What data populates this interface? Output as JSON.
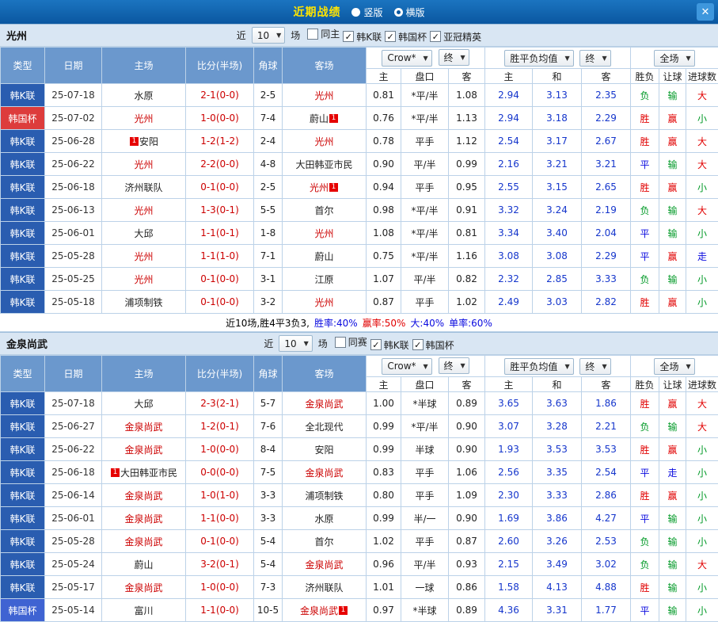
{
  "titlebar": {
    "title": "近期战绩",
    "radios": [
      {
        "label": "竖版",
        "selected": false
      },
      {
        "label": "横版",
        "selected": true
      }
    ],
    "close_label": "✕"
  },
  "icons": {
    "arrow": "▼",
    "check": "✓",
    "badge": "1"
  },
  "palette": {
    "k": "#2a5db0",
    "cupRed": "#dd3c3c",
    "cupBlue": "#3f63d2"
  },
  "result_colors": {
    "胜": "#e10000",
    "赢": "#e10000",
    "大": "#e10000",
    "平": "#0a0adf",
    "走": "#0a0adf",
    "负": "#009926",
    "输": "#009926",
    "小": "#009926"
  },
  "head": {
    "cols": [
      "类型",
      "日期",
      "主场",
      "比分(半场)",
      "角球",
      "客场"
    ],
    "odds_select": "Crow*",
    "final_select": "终",
    "europe_select": "胜平负均值",
    "scope_select": "全场",
    "sub": [
      "主",
      "盘口",
      "客",
      "主",
      "和",
      "客",
      "胜负",
      "让球",
      "进球数"
    ]
  },
  "filters_shared": {
    "near": "近",
    "count": "10",
    "games": "场"
  },
  "sections": [
    {
      "team": "光州",
      "filters": {
        "checks": [
          {
            "label": "同主",
            "checked": false
          },
          {
            "label": "韩K联",
            "checked": true
          },
          {
            "label": "韩国杯",
            "checked": true
          },
          {
            "label": "亚冠精英",
            "checked": true
          }
        ]
      },
      "rows": [
        {
          "t": "韩K联",
          "tc": "k",
          "d": "25-07-18",
          "h": "水原",
          "hf": false,
          "hb": "",
          "s": "2-1(0-0)",
          "c": "2-5",
          "a": "光州",
          "af": true,
          "ab": "",
          "o": [
            "0.81",
            "*平/半",
            "1.08"
          ],
          "e": [
            "2.94",
            "3.13",
            "2.35"
          ],
          "r": [
            "负",
            "输",
            "大"
          ]
        },
        {
          "t": "韩国杯",
          "tc": "cupRed",
          "d": "25-07-02",
          "h": "光州",
          "hf": true,
          "hb": "",
          "s": "1-0(0-0)",
          "c": "7-4",
          "a": "蔚山",
          "af": false,
          "ab": "post",
          "o": [
            "0.76",
            "*平/半",
            "1.13"
          ],
          "e": [
            "2.94",
            "3.18",
            "2.29"
          ],
          "r": [
            "胜",
            "赢",
            "小"
          ]
        },
        {
          "t": "韩K联",
          "tc": "k",
          "d": "25-06-28",
          "h": "安阳",
          "hf": false,
          "hb": "pre",
          "s": "1-2(1-2)",
          "c": "2-4",
          "a": "光州",
          "af": true,
          "ab": "",
          "o": [
            "0.78",
            "平手",
            "1.12"
          ],
          "e": [
            "2.54",
            "3.17",
            "2.67"
          ],
          "r": [
            "胜",
            "赢",
            "大"
          ]
        },
        {
          "t": "韩K联",
          "tc": "k",
          "d": "25-06-22",
          "h": "光州",
          "hf": true,
          "hb": "",
          "s": "2-2(0-0)",
          "c": "4-8",
          "a": "大田韩亚市民",
          "af": false,
          "ab": "",
          "o": [
            "0.90",
            "平/半",
            "0.99"
          ],
          "e": [
            "2.16",
            "3.21",
            "3.21"
          ],
          "r": [
            "平",
            "输",
            "大"
          ]
        },
        {
          "t": "韩K联",
          "tc": "k",
          "d": "25-06-18",
          "h": "济州联队",
          "hf": false,
          "hb": "",
          "s": "0-1(0-0)",
          "c": "2-5",
          "a": "光州",
          "af": true,
          "ab": "post",
          "o": [
            "0.94",
            "平手",
            "0.95"
          ],
          "e": [
            "2.55",
            "3.15",
            "2.65"
          ],
          "r": [
            "胜",
            "赢",
            "小"
          ]
        },
        {
          "t": "韩K联",
          "tc": "k",
          "d": "25-06-13",
          "h": "光州",
          "hf": true,
          "hb": "",
          "s": "1-3(0-1)",
          "c": "5-5",
          "a": "首尔",
          "af": false,
          "ab": "",
          "o": [
            "0.98",
            "*平/半",
            "0.91"
          ],
          "e": [
            "3.32",
            "3.24",
            "2.19"
          ],
          "r": [
            "负",
            "输",
            "大"
          ]
        },
        {
          "t": "韩K联",
          "tc": "k",
          "d": "25-06-01",
          "h": "大邱",
          "hf": false,
          "hb": "",
          "s": "1-1(0-1)",
          "c": "1-8",
          "a": "光州",
          "af": true,
          "ab": "",
          "o": [
            "1.08",
            "*平/半",
            "0.81"
          ],
          "e": [
            "3.34",
            "3.40",
            "2.04"
          ],
          "r": [
            "平",
            "输",
            "小"
          ]
        },
        {
          "t": "韩K联",
          "tc": "k",
          "d": "25-05-28",
          "h": "光州",
          "hf": true,
          "hb": "",
          "s": "1-1(1-0)",
          "c": "7-1",
          "a": "蔚山",
          "af": false,
          "ab": "",
          "o": [
            "0.75",
            "*平/半",
            "1.16"
          ],
          "e": [
            "3.08",
            "3.08",
            "2.29"
          ],
          "r": [
            "平",
            "赢",
            "走"
          ]
        },
        {
          "t": "韩K联",
          "tc": "k",
          "d": "25-05-25",
          "h": "光州",
          "hf": true,
          "hb": "",
          "s": "0-1(0-0)",
          "c": "3-1",
          "a": "江原",
          "af": false,
          "ab": "",
          "o": [
            "1.07",
            "平/半",
            "0.82"
          ],
          "e": [
            "2.32",
            "2.85",
            "3.33"
          ],
          "r": [
            "负",
            "输",
            "小"
          ]
        },
        {
          "t": "韩K联",
          "tc": "k",
          "d": "25-05-18",
          "h": "浦项制铁",
          "hf": false,
          "hb": "",
          "s": "0-1(0-0)",
          "c": "3-2",
          "a": "光州",
          "af": true,
          "ab": "",
          "o": [
            "0.87",
            "平手",
            "1.02"
          ],
          "e": [
            "2.49",
            "3.03",
            "2.82"
          ],
          "r": [
            "胜",
            "赢",
            "小"
          ]
        }
      ],
      "summary": [
        {
          "text": "近10场,胜4平3负3,",
          "color": "#000000"
        },
        {
          "text": "胜率:40%",
          "color": "#0a0adf"
        },
        {
          "text": "赢率:50%",
          "color": "#e10000"
        },
        {
          "text": "大:40%",
          "color": "#0a0adf"
        },
        {
          "text": "单率:60%",
          "color": "#0a0adf"
        }
      ]
    },
    {
      "team": "金泉尚武",
      "filters": {
        "checks": [
          {
            "label": "同赛",
            "checked": false
          },
          {
            "label": "韩K联",
            "checked": true
          },
          {
            "label": "韩国杯",
            "checked": true
          }
        ]
      },
      "rows": [
        {
          "t": "韩K联",
          "tc": "k",
          "d": "25-07-18",
          "h": "大邱",
          "hf": false,
          "hb": "",
          "s": "2-3(2-1)",
          "c": "5-7",
          "a": "金泉尚武",
          "af": true,
          "ab": "",
          "o": [
            "1.00",
            "*半球",
            "0.89"
          ],
          "e": [
            "3.65",
            "3.63",
            "1.86"
          ],
          "r": [
            "胜",
            "赢",
            "大"
          ]
        },
        {
          "t": "韩K联",
          "tc": "k",
          "d": "25-06-27",
          "h": "金泉尚武",
          "hf": true,
          "hb": "",
          "s": "1-2(0-1)",
          "c": "7-6",
          "a": "全北现代",
          "af": false,
          "ab": "",
          "o": [
            "0.99",
            "*平/半",
            "0.90"
          ],
          "e": [
            "3.07",
            "3.28",
            "2.21"
          ],
          "r": [
            "负",
            "输",
            "大"
          ]
        },
        {
          "t": "韩K联",
          "tc": "k",
          "d": "25-06-22",
          "h": "金泉尚武",
          "hf": true,
          "hb": "",
          "s": "1-0(0-0)",
          "c": "8-4",
          "a": "安阳",
          "af": false,
          "ab": "",
          "o": [
            "0.99",
            "半球",
            "0.90"
          ],
          "e": [
            "1.93",
            "3.53",
            "3.53"
          ],
          "r": [
            "胜",
            "赢",
            "小"
          ]
        },
        {
          "t": "韩K联",
          "tc": "k",
          "d": "25-06-18",
          "h": "大田韩亚市民",
          "hf": false,
          "hb": "pre",
          "s": "0-0(0-0)",
          "c": "7-5",
          "a": "金泉尚武",
          "af": true,
          "ab": "",
          "o": [
            "0.83",
            "平手",
            "1.06"
          ],
          "e": [
            "2.56",
            "3.35",
            "2.54"
          ],
          "r": [
            "平",
            "走",
            "小"
          ]
        },
        {
          "t": "韩K联",
          "tc": "k",
          "d": "25-06-14",
          "h": "金泉尚武",
          "hf": true,
          "hb": "",
          "s": "1-0(1-0)",
          "c": "3-3",
          "a": "浦项制铁",
          "af": false,
          "ab": "",
          "o": [
            "0.80",
            "平手",
            "1.09"
          ],
          "e": [
            "2.30",
            "3.33",
            "2.86"
          ],
          "r": [
            "胜",
            "赢",
            "小"
          ]
        },
        {
          "t": "韩K联",
          "tc": "k",
          "d": "25-06-01",
          "h": "金泉尚武",
          "hf": true,
          "hb": "",
          "s": "1-1(0-0)",
          "c": "3-3",
          "a": "水原",
          "af": false,
          "ab": "",
          "o": [
            "0.99",
            "半/一",
            "0.90"
          ],
          "e": [
            "1.69",
            "3.86",
            "4.27"
          ],
          "r": [
            "平",
            "输",
            "小"
          ]
        },
        {
          "t": "韩K联",
          "tc": "k",
          "d": "25-05-28",
          "h": "金泉尚武",
          "hf": true,
          "hb": "",
          "s": "0-1(0-0)",
          "c": "5-4",
          "a": "首尔",
          "af": false,
          "ab": "",
          "o": [
            "1.02",
            "平手",
            "0.87"
          ],
          "e": [
            "2.60",
            "3.26",
            "2.53"
          ],
          "r": [
            "负",
            "输",
            "小"
          ]
        },
        {
          "t": "韩K联",
          "tc": "k",
          "d": "25-05-24",
          "h": "蔚山",
          "hf": false,
          "hb": "",
          "s": "3-2(0-1)",
          "c": "5-4",
          "a": "金泉尚武",
          "af": true,
          "ab": "",
          "o": [
            "0.96",
            "平/半",
            "0.93"
          ],
          "e": [
            "2.15",
            "3.49",
            "3.02"
          ],
          "r": [
            "负",
            "输",
            "大"
          ]
        },
        {
          "t": "韩K联",
          "tc": "k",
          "d": "25-05-17",
          "h": "金泉尚武",
          "hf": true,
          "hb": "",
          "s": "1-0(0-0)",
          "c": "7-3",
          "a": "济州联队",
          "af": false,
          "ab": "",
          "o": [
            "1.01",
            "一球",
            "0.86"
          ],
          "e": [
            "1.58",
            "4.13",
            "4.88"
          ],
          "r": [
            "胜",
            "输",
            "小"
          ]
        },
        {
          "t": "韩国杯",
          "tc": "cupBlue",
          "d": "25-05-14",
          "h": "富川",
          "hf": false,
          "hb": "",
          "s": "1-1(0-0)",
          "c": "10-5",
          "a": "金泉尚武",
          "af": true,
          "ab": "post",
          "o": [
            "0.97",
            "*半球",
            "0.89"
          ],
          "e": [
            "4.36",
            "3.31",
            "1.77"
          ],
          "r": [
            "平",
            "输",
            "小"
          ]
        }
      ]
    }
  ]
}
